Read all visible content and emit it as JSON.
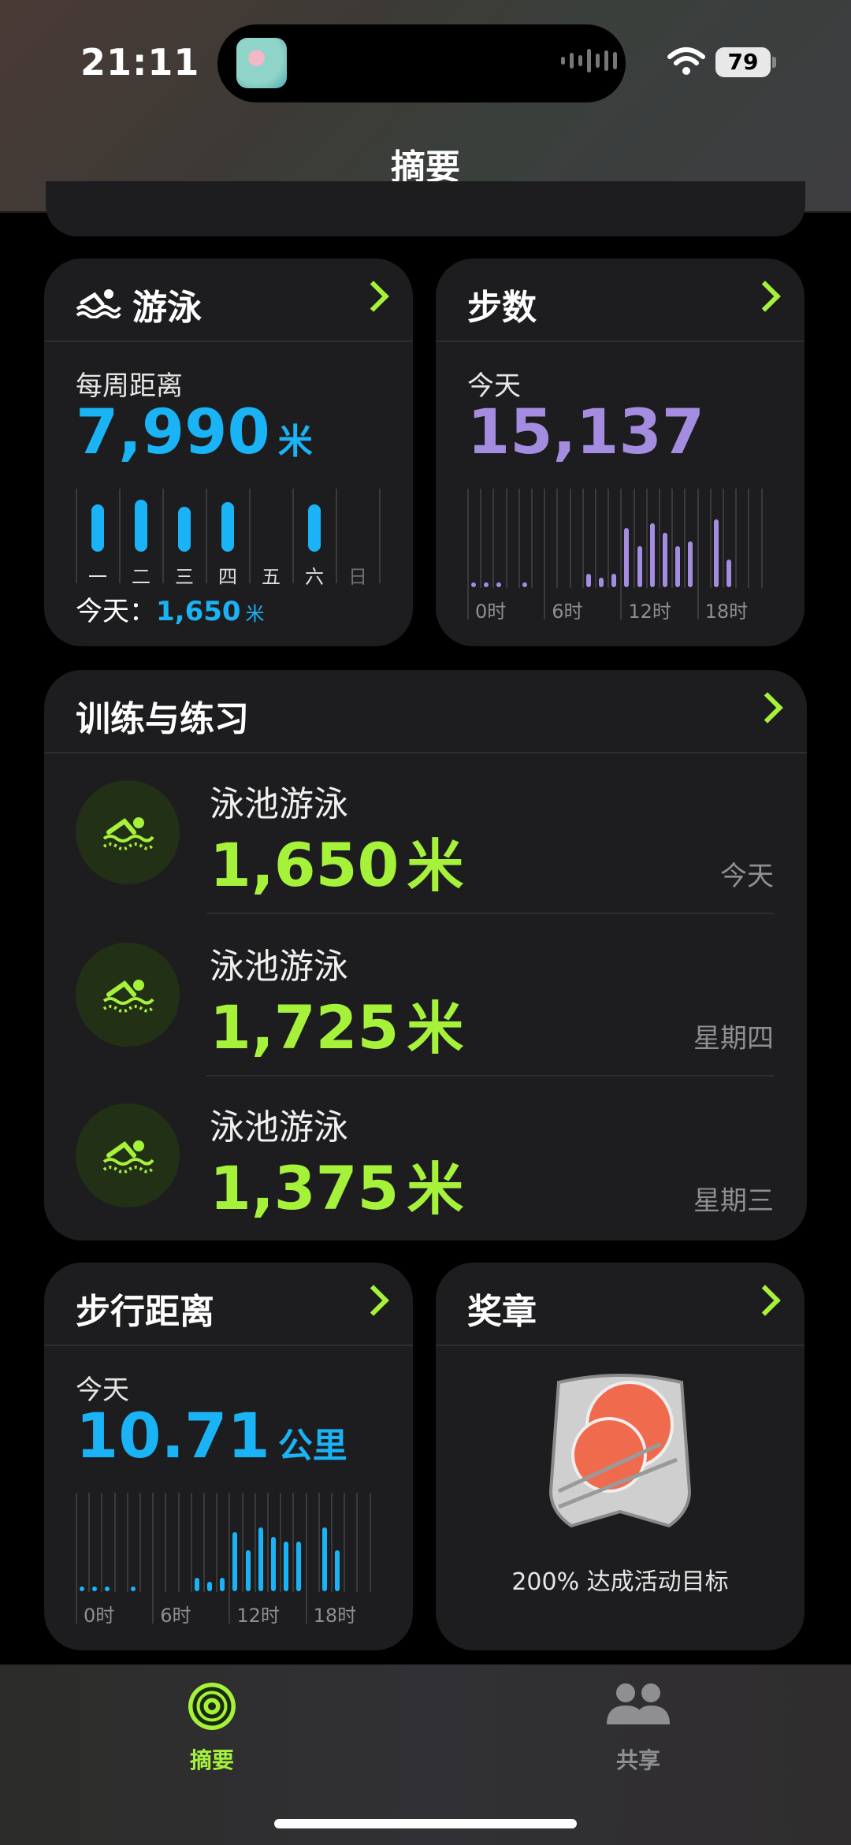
{
  "status_bar": {
    "time": "21:11",
    "battery": "79"
  },
  "header": {
    "title": "摘要"
  },
  "swim_card": {
    "title": "游泳",
    "subtitle": "每周距离",
    "value": "7,990",
    "unit": "米",
    "days": [
      "一",
      "二",
      "三",
      "四",
      "五",
      "六",
      "日"
    ],
    "day_values": [
      1,
      1.1,
      0.95,
      1.05,
      0,
      1,
      0
    ],
    "today_label": "今天：",
    "today_value": "1,650",
    "today_unit": "米"
  },
  "steps_card": {
    "title": "步数",
    "subtitle": "今天",
    "value": "15,137",
    "ticks": [
      "0时",
      "6时",
      "12时",
      "18时"
    ]
  },
  "workouts_card": {
    "title": "训练与练习",
    "items": [
      {
        "name": "泳池游泳",
        "distance": "1,650",
        "unit": "米",
        "date": "今天"
      },
      {
        "name": "泳池游泳",
        "distance": "1,725",
        "unit": "米",
        "date": "星期四"
      },
      {
        "name": "泳池游泳",
        "distance": "1,375",
        "unit": "米",
        "date": "星期三"
      }
    ]
  },
  "walk_card": {
    "title": "步行距离",
    "subtitle": "今天",
    "value": "10.71",
    "unit": "公里",
    "ticks": [
      "0时",
      "6时",
      "12时",
      "18时"
    ]
  },
  "awards_card": {
    "title": "奖章",
    "caption": "200% 达成活动目标"
  },
  "tab_bar": {
    "items": [
      {
        "label": "摘要",
        "active": true
      },
      {
        "label": "共享",
        "active": false
      }
    ]
  },
  "colors": {
    "accent": "#a6f23a",
    "swim_blue": "#1ab3f5",
    "steps_purple": "#a48de0",
    "card_bg": "#1d1d1f"
  },
  "chart_data": [
    {
      "type": "bar",
      "title": "每周距离",
      "categories": [
        "一",
        "二",
        "三",
        "四",
        "五",
        "六",
        "日"
      ],
      "values": [
        1,
        1.1,
        0.95,
        1.05,
        0,
        1,
        0
      ]
    },
    {
      "type": "bar",
      "title": "步数",
      "x": [
        "0时",
        "1时",
        "2时",
        "3时",
        "4时",
        "5时",
        "6时",
        "7时",
        "8时",
        "9时",
        "10时",
        "11时",
        "12时",
        "13时",
        "14时",
        "15时",
        "16时",
        "17时",
        "18时",
        "19时",
        "20时",
        "21时",
        "22时",
        "23时"
      ],
      "values": [
        0.05,
        0.05,
        0.05,
        0,
        0.05,
        0,
        0,
        0,
        0,
        0.15,
        0.1,
        0.15,
        0.65,
        0.45,
        0.7,
        0.6,
        0.45,
        0.5,
        0,
        0.75,
        0.3,
        0,
        0,
        0
      ]
    },
    {
      "type": "bar",
      "title": "步行距离",
      "x": [
        "0时",
        "1时",
        "2时",
        "3时",
        "4时",
        "5时",
        "6时",
        "7时",
        "8时",
        "9时",
        "10时",
        "11时",
        "12时",
        "13时",
        "14时",
        "15时",
        "16时",
        "17时",
        "18时",
        "19时",
        "20时",
        "21时",
        "22时",
        "23时"
      ],
      "values": [
        0.05,
        0.05,
        0.05,
        0,
        0.05,
        0,
        0,
        0,
        0,
        0.15,
        0.1,
        0.15,
        0.65,
        0.45,
        0.7,
        0.6,
        0.55,
        0.55,
        0,
        0.7,
        0.45,
        0,
        0,
        0
      ]
    }
  ]
}
